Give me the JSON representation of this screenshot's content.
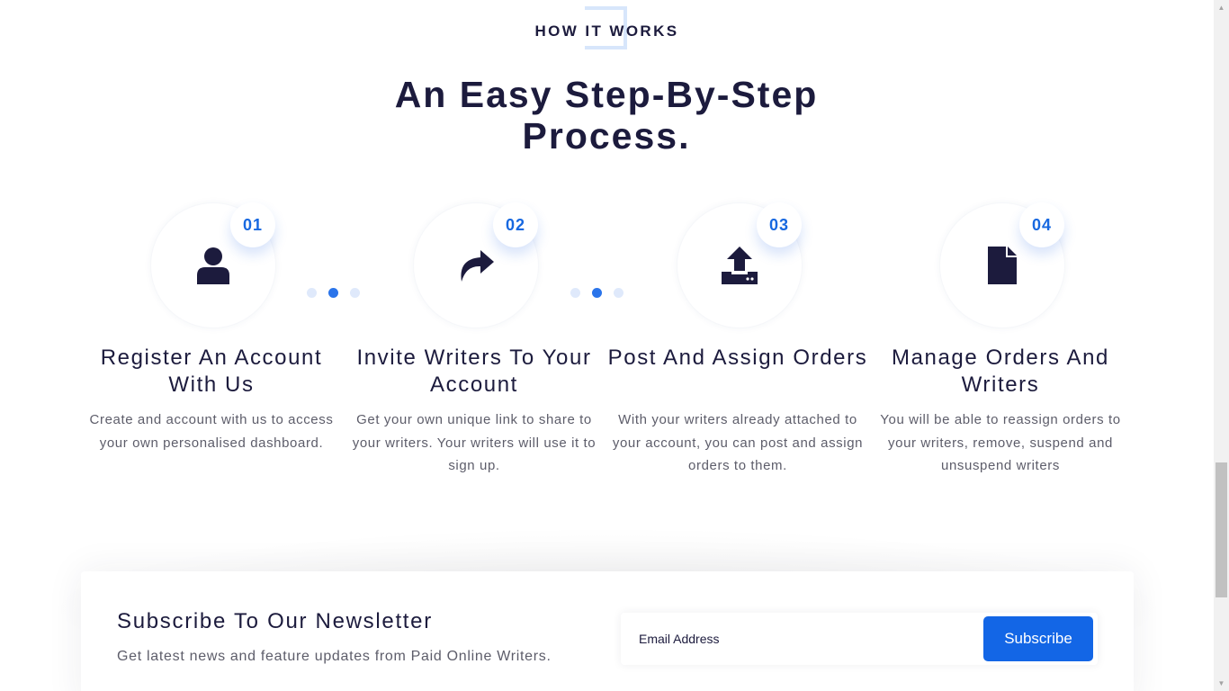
{
  "section": {
    "eyebrow": "HOW IT WORKS",
    "headline": "An Easy Step-By-Step Process."
  },
  "steps": [
    {
      "number": "01",
      "icon": "user-icon",
      "title": "Register An Account With Us",
      "description": "Create and account with us to access your own personalised dashboard."
    },
    {
      "number": "02",
      "icon": "share-arrow-icon",
      "title": "Invite Writers To Your Account",
      "description": "Get your own unique link to share to your writers. Your writers will use it to sign up."
    },
    {
      "number": "03",
      "icon": "upload-icon",
      "title": "Post And Assign Orders",
      "description": "With your writers already attached to your account, you can post and assign orders to them."
    },
    {
      "number": "04",
      "icon": "file-icon",
      "title": "Manage Orders And Writers",
      "description": "You will be able to reassign orders to your writers, remove, suspend and unsuspend writers"
    }
  ],
  "newsletter": {
    "title": "Subscribe To Our Newsletter",
    "subtitle": "Get latest news and feature updates from Paid Online Writers.",
    "email_placeholder": "Email Address",
    "subscribe_label": "Subscribe"
  },
  "colors": {
    "heading": "#1c1b3d",
    "accent": "#1366e6",
    "step_number": "#1768e0",
    "dot_active": "#2a74ea",
    "dot_inactive": "#dfe9fb"
  }
}
